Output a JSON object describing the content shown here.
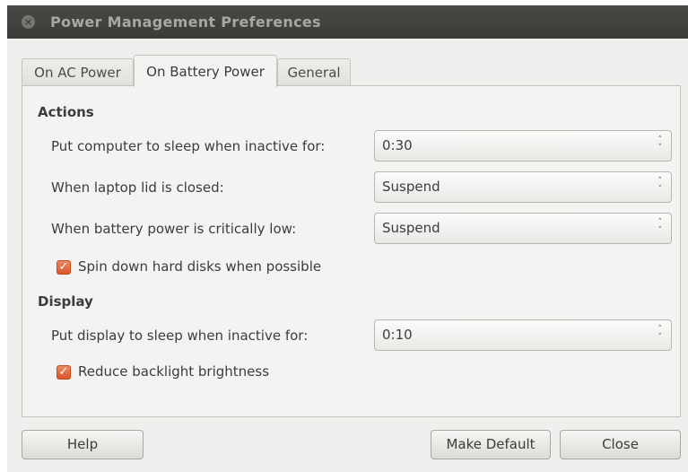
{
  "window": {
    "title": "Power Management Preferences",
    "close_glyph": "×"
  },
  "tabs": [
    {
      "label": "On AC Power",
      "active": false
    },
    {
      "label": "On Battery Power",
      "active": true
    },
    {
      "label": "General",
      "active": false
    }
  ],
  "actions": {
    "heading": "Actions",
    "sleep_label": "Put computer to sleep when inactive for:",
    "sleep_value": "0:30",
    "lid_label": "When laptop lid is closed:",
    "lid_value": "Suspend",
    "critical_label": "When battery power is critically low:",
    "critical_value": "Suspend",
    "spin_down_label": "Spin down hard disks when possible",
    "spin_down_checked": true
  },
  "display": {
    "heading": "Display",
    "sleep_label": "Put display to sleep when inactive for:",
    "sleep_value": "0:10",
    "backlight_label": "Reduce backlight brightness",
    "backlight_checked": true
  },
  "buttons": {
    "help": "Help",
    "make_default": "Make Default",
    "close": "Close"
  },
  "icons": {
    "checkmark": "✓",
    "arrow_up": "˄",
    "arrow_down": "˅"
  },
  "colors": {
    "titlebar": "#3c3b37",
    "checkbox_accent": "#dd5a2c",
    "window_bg": "#f1efed"
  }
}
